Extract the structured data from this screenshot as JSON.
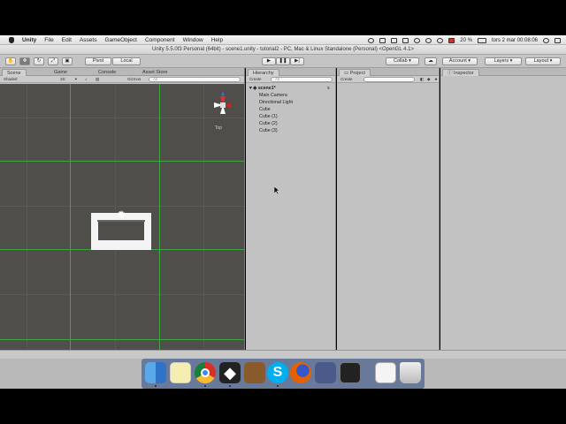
{
  "menubar": {
    "app_name": "Unity",
    "items": [
      "File",
      "Edit",
      "Assets",
      "GameObject",
      "Component",
      "Window",
      "Help"
    ],
    "battery": "20 %",
    "datetime": "tors 2 mar  00:08:06"
  },
  "window": {
    "title": "Unity 5.5.0f3 Personal (64bit) - scene1.unity - tutorial2 - PC, Mac & Linux Standalone (Personal) <OpenGL 4.1>"
  },
  "toolbar": {
    "pivot_label": "Pivot",
    "local_label": "Local",
    "collab_label": "Collab",
    "account_label": "Account",
    "layers_label": "Layers",
    "layout_label": "Layout"
  },
  "scene_panel": {
    "tabs": [
      "Scene",
      "Game",
      "Console",
      "Asset Store"
    ],
    "shading_mode": "Shaded",
    "mode_2d": "2D",
    "gizmos_label": "Gizmos",
    "search_placeholder": "All",
    "gizmo_view_label": "Top"
  },
  "hierarchy_panel": {
    "tab": "Hierarchy",
    "create_label": "Create",
    "search_placeholder": "All",
    "scene_name": "scene1*",
    "items": [
      "Main Camera",
      "Directional Light",
      "Cube",
      "Cube (1)",
      "Cube (2)",
      "Cube (3)"
    ]
  },
  "project_panel": {
    "tab": "Project",
    "create_label": "Create"
  },
  "inspector_panel": {
    "tab": "Inspector"
  },
  "dock": {
    "apps": [
      "finder-icon",
      "notes-icon",
      "chrome-icon",
      "unity-icon",
      "books-icon",
      "skype-icon",
      "firefox-icon",
      "imovie-icon",
      "terminal-icon",
      "document-icon",
      "trash-icon"
    ]
  },
  "colors": {
    "grid_line": "#3ea542",
    "scene_bg": "#4f4e4b",
    "panel_bg": "#c2c2c2"
  }
}
